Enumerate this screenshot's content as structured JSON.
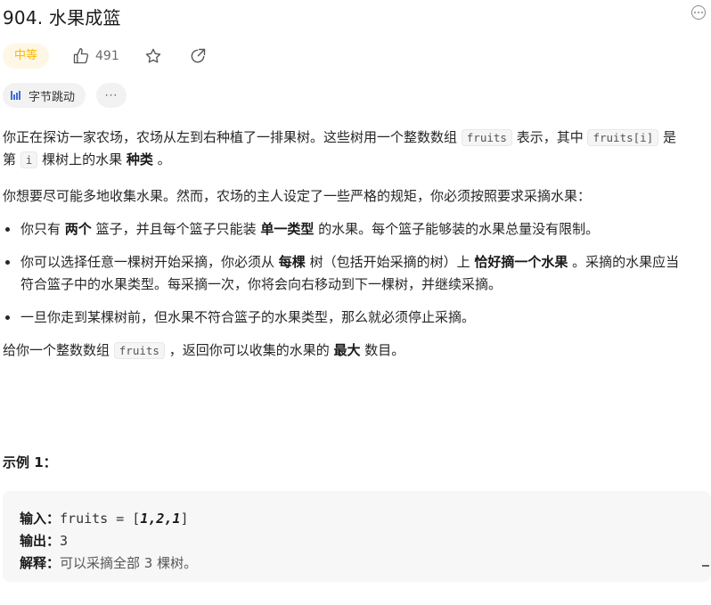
{
  "problem": {
    "title": "904. 水果成篮",
    "difficulty": "中等",
    "likes": "491"
  },
  "tags": {
    "company": "字节跳动",
    "more": "···"
  },
  "icons": {
    "options": "more-options-icon",
    "like": "thumbs-up-icon",
    "favorite": "star-icon",
    "share": "share-icon",
    "company": "bar-chart-icon"
  },
  "colors": {
    "difficulty_text": "#ffb800",
    "difficulty_bg": "#fef7e6",
    "company_icon": "#3c6fd8"
  },
  "description": {
    "p1": {
      "t1": "你正在探访一家农场，农场从左到右种植了一排果树。这些树用一个整数数组 ",
      "c1": "fruits",
      "t2": " 表示，其中 ",
      "c2": "fruits[i]",
      "t3": " 是第 ",
      "c3": "i",
      "t4": " 棵树上的水果 ",
      "b1": "种类",
      "t5": " 。"
    },
    "p2": "你想要尽可能多地收集水果。然而，农场的主人设定了一些严格的规矩，你必须按照要求采摘水果：",
    "rules": [
      {
        "t1": "你只有 ",
        "b1": "两个",
        "t2": " 篮子，并且每个篮子只能装 ",
        "b2": "单一类型",
        "t3": " 的水果。每个篮子能够装的水果总量没有限制。"
      },
      {
        "t1": "你可以选择任意一棵树开始采摘，你必须从 ",
        "b1": "每棵",
        "t2": " 树（包括开始采摘的树）上 ",
        "b2": "恰好摘一个水果",
        "t3": " 。采摘的水果应当符合篮子中的水果类型。每采摘一次，你将会向右移动到下一棵树，并继续采摘。"
      },
      {
        "t1": "一旦你走到某棵树前，但水果不符合篮子的水果类型，那么就必须停止采摘。"
      }
    ],
    "p3": {
      "t1": "给你一个整数数组 ",
      "c1": "fruits",
      "t2": " ，返回你可以收集的水果的 ",
      "b1": "最大",
      "t3": " 数目。"
    }
  },
  "example": {
    "title": "示例 1：",
    "input_label": "输入：",
    "input_prefix": "fruits = [",
    "input_values": "1,2,1",
    "input_suffix": "]",
    "output_label": "输出：",
    "output_value": "3",
    "explain_label": "解释：",
    "explain_text": "可以采摘全部 3 棵树。"
  }
}
